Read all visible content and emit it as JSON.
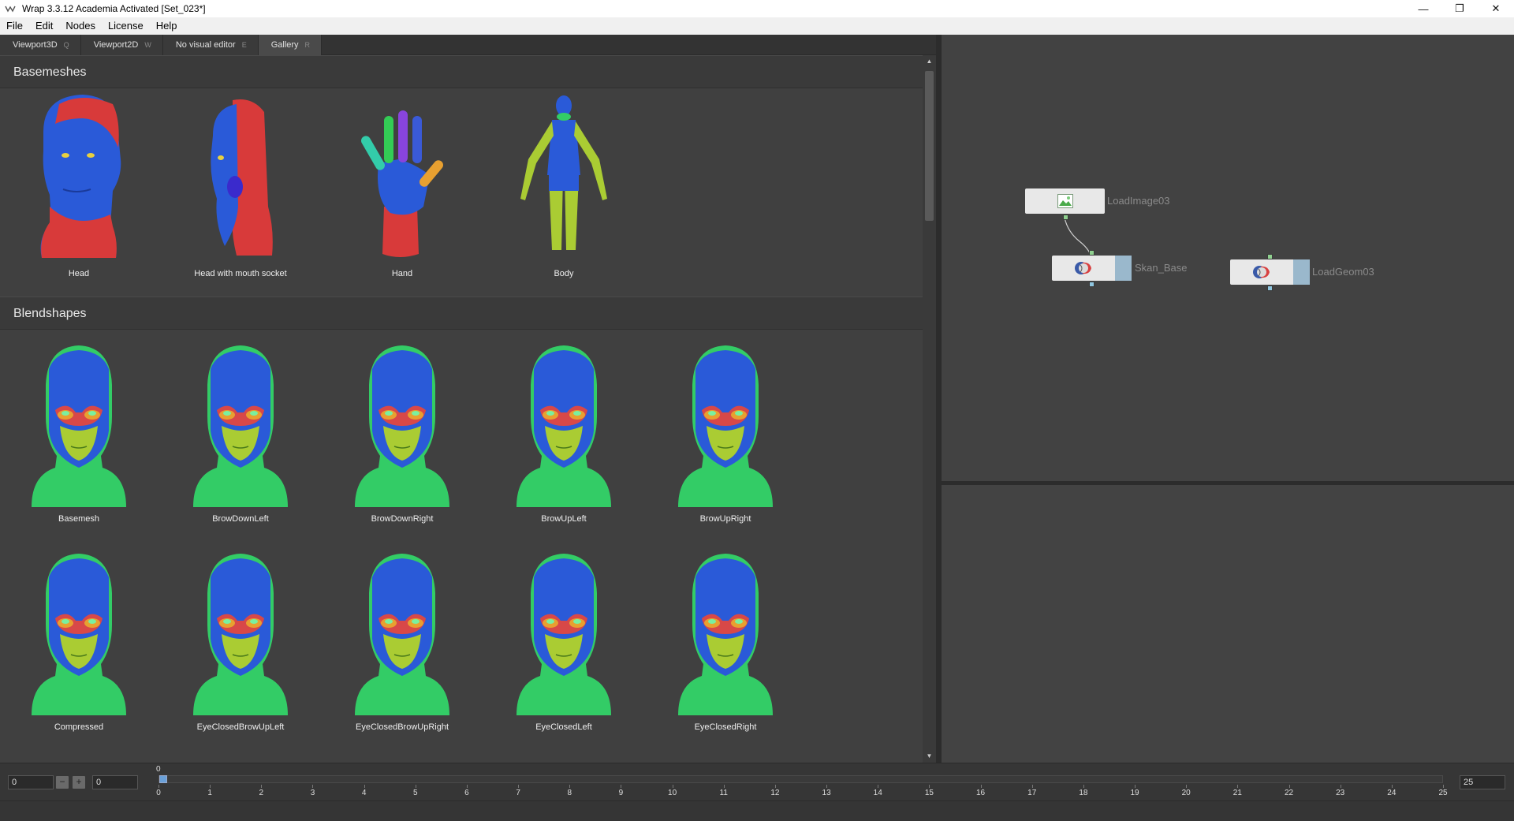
{
  "window": {
    "title": "Wrap 3.3.12 Academia Activated [Set_023*]",
    "minimize": "—",
    "maximize": "❐",
    "close": "✕"
  },
  "menu": [
    "File",
    "Edit",
    "Nodes",
    "License",
    "Help"
  ],
  "tabs": [
    {
      "label": "Viewport3D",
      "hotkey": "Q",
      "active": false
    },
    {
      "label": "Viewport2D",
      "hotkey": "W",
      "active": false
    },
    {
      "label": "No visual editor",
      "hotkey": "E",
      "active": false
    },
    {
      "label": "Gallery",
      "hotkey": "R",
      "active": true
    }
  ],
  "gallery": {
    "basemeshes": {
      "title": "Basemeshes",
      "items": [
        "Head",
        "Head with mouth socket",
        "Hand",
        "Body"
      ]
    },
    "blendshapes": {
      "title": "Blendshapes",
      "items": [
        "Basemesh",
        "BrowDownLeft",
        "BrowDownRight",
        "BrowUpLeft",
        "BrowUpRight",
        "Compressed",
        "EyeClosedBrowUpLeft",
        "EyeClosedBrowUpRight",
        "EyeClosedLeft",
        "EyeClosedRight"
      ]
    }
  },
  "nodes": [
    {
      "name": "LoadImage03",
      "icon": "image-icon"
    },
    {
      "name": "Skan_Base",
      "icon": "geometry-icon"
    },
    {
      "name": "LoadGeom03",
      "icon": "geometry-icon"
    }
  ],
  "timeline": {
    "start": "0",
    "current": "0",
    "end": "25",
    "cursor_label": "0",
    "ticks": [
      "0",
      "1",
      "2",
      "3",
      "4",
      "5",
      "6",
      "7",
      "8",
      "9",
      "10",
      "11",
      "12",
      "13",
      "14",
      "15",
      "16",
      "17",
      "18",
      "19",
      "20",
      "21",
      "22",
      "23",
      "24",
      "25"
    ],
    "minus": "−",
    "plus": "+"
  },
  "colors": {
    "mesh_blue": "#2255dd",
    "mesh_red": "#dd3333",
    "mesh_green": "#33cc66",
    "mesh_yellow": "#aacc33",
    "node_bg": "#e8e8e8"
  }
}
